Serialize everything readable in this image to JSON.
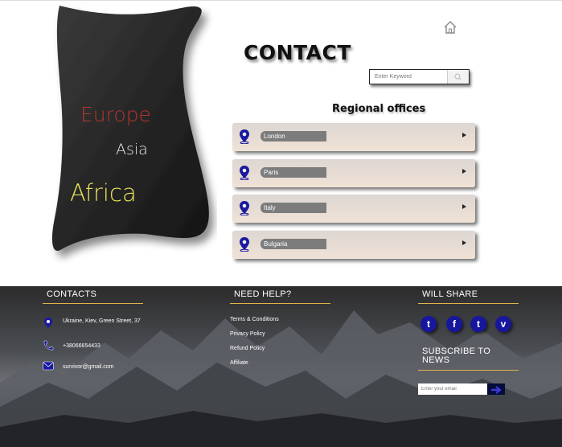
{
  "regions": {
    "europe": "Europe",
    "asia": "Asia",
    "africa": "Africa"
  },
  "header": {
    "title": "CONTACT"
  },
  "search": {
    "placeholder": "Enter Keyword"
  },
  "offices": {
    "title": "Regional offices",
    "items": [
      {
        "label": "London"
      },
      {
        "label": "Paris"
      },
      {
        "label": "Italy"
      },
      {
        "label": "Bulgaria"
      }
    ]
  },
  "footer": {
    "contacts": {
      "heading": "CONTACTS",
      "address": "Ukraine, Kiev, Green Street, 37",
      "phone": "+38066654433",
      "email": "survivor@gmail.com"
    },
    "help": {
      "heading": "NEED HELP?",
      "links": [
        "Terms & Conditions",
        "Privacy Policy",
        "Refund Policy",
        "Affiliate"
      ]
    },
    "share": {
      "heading": "WILL SHARE",
      "socials": [
        {
          "icon": "twitter-icon",
          "glyph": "t"
        },
        {
          "icon": "facebook-icon",
          "glyph": "f"
        },
        {
          "icon": "tumblr-icon",
          "glyph": "t"
        },
        {
          "icon": "vimeo-icon",
          "glyph": "v"
        }
      ],
      "subscribe_heading": "SUBSCRIBE TO NEWS",
      "email_placeholder": "Enter your email"
    }
  },
  "colors": {
    "accent_line": "#e0b44a",
    "social_bg": "#17179e",
    "pin": "#1a1aa0",
    "europe": "#b23530",
    "africa": "#ece45a"
  }
}
